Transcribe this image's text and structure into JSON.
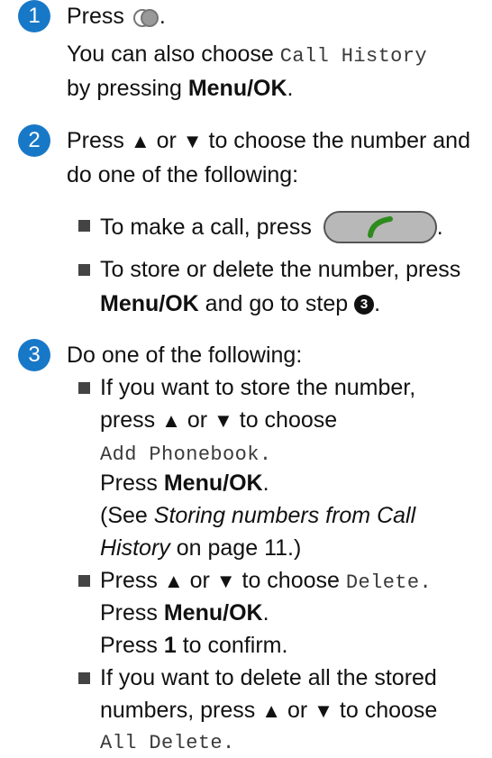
{
  "steps": {
    "step1": {
      "number": "1",
      "line1_text": "Press",
      "line1_end": ".",
      "line2_text": "You can also choose",
      "line2_code": "Call History",
      "line3_text": "by pressing",
      "line3_bold": "Menu/OK",
      "line3_end": "."
    },
    "step2": {
      "number": "2",
      "line1_a": "Press",
      "up": "▲",
      "or": "or",
      "down": "▼",
      "line1_b": "to choose the number and",
      "line2": "do one of the following:",
      "bullet1_text": "To make a call, press",
      "bullet1_end": ".",
      "bullet2_line1": "To store or delete the number, press",
      "bullet2_bold": "Menu/OK",
      "bullet2_mid": "and go to step",
      "step_ref": "3",
      "bullet2_end": "."
    },
    "step3": {
      "number": "3",
      "intro": "Do one of the following:",
      "b1_l1": "If you want to store the number,",
      "press": "press",
      "to_choose": "to choose",
      "b1_code": "Add Phonebook",
      "b1_code_end": ".",
      "press_menu": "Press",
      "menu_ok": "Menu/OK",
      "period": ".",
      "see_open": "(See",
      "see_italic1": "Storing numbers from Call",
      "see_italic2": "History",
      "see_rest": "on page 11.)",
      "b2_press": "Press",
      "b2_code": "Delete",
      "confirm_pre": "Press",
      "confirm_key": "1",
      "confirm_post": "to confirm.",
      "b3_l1": "If you want to delete all the stored",
      "b3_l2": "numbers, press",
      "b3_code": "All Delete"
    }
  },
  "colors": {
    "step_circle": "#1878c8",
    "call_button": "#b8b8b8",
    "handset": "#2e8b1e"
  },
  "icons": {
    "history": "call-history-icon",
    "call": "phone-handset-icon"
  }
}
